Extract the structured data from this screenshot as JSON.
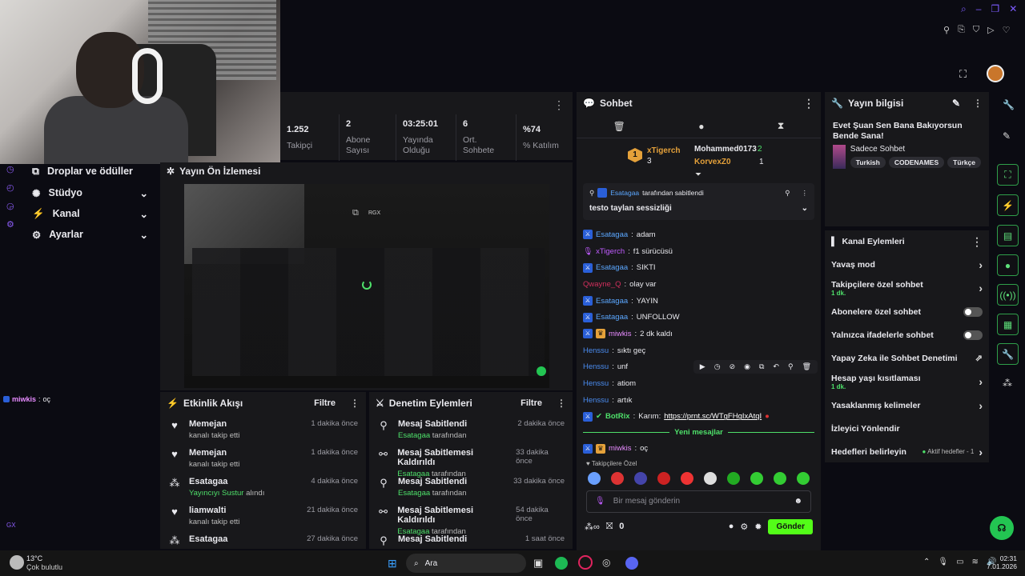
{
  "window": {
    "top_icons": [
      "search-icon",
      "minimize-icon",
      "maximize-icon",
      "close-icon"
    ],
    "action_icons": [
      "pin-icon",
      "clip-icon",
      "shield-icon",
      "play-icon",
      "heart-icon"
    ]
  },
  "nav": {
    "items": [
      {
        "label": "Droplar ve ödüller",
        "icon": "gift-icon"
      },
      {
        "label": "Stüdyo",
        "icon": "gear-icon"
      },
      {
        "label": "Kanal",
        "icon": "channel-icon"
      },
      {
        "label": "Ayarlar",
        "icon": "gear-icon"
      }
    ]
  },
  "left_chat": {
    "user": "miwkis",
    "message": "oç",
    "bottom_label": "GX"
  },
  "stats": [
    {
      "value": "1.252",
      "label": "Takipçi"
    },
    {
      "value": "2",
      "label": "Abone Sayısı"
    },
    {
      "value": "03:25:01",
      "label": "Yayında Olduğu"
    },
    {
      "value": "6",
      "label": "Ort. Sohbete"
    },
    {
      "value": "%74",
      "label": "% Katılım"
    }
  ],
  "preview": {
    "title": "Yayın Ön İzlemesi",
    "badge": "RGX"
  },
  "activity": {
    "title": "Etkinlik Akışı",
    "filter": "Filtre",
    "items": [
      {
        "icon": "heart-icon",
        "name": "Memejan",
        "detail": "kanalı takip etti",
        "time": "1 dakika önce"
      },
      {
        "icon": "heart-icon",
        "name": "Memejan",
        "detail": "kanalı takip etti",
        "time": "1 dakika önce"
      },
      {
        "icon": "points-icon",
        "name": "Esatagaa",
        "detail_highlight": "Yayıncıyı Sustur",
        "detail": "alındı",
        "time": "4 dakika önce"
      },
      {
        "icon": "heart-icon",
        "name": "liamwalti",
        "detail": "kanalı takip etti",
        "time": "21 dakika önce"
      },
      {
        "icon": "points-icon",
        "name": "Esatagaa",
        "detail": "",
        "time": "27 dakika önce"
      }
    ]
  },
  "moderation": {
    "title": "Denetim Eylemleri",
    "filter": "Filtre",
    "items": [
      {
        "icon": "pin-icon",
        "action": "Mesaj Sabitlendi",
        "by": "Esatagaa",
        "suffix": "tarafından",
        "time": "2 dakika önce"
      },
      {
        "icon": "unpin-icon",
        "action": "Mesaj Sabitlemesi Kaldırıldı",
        "by": "Esatagaa",
        "suffix": "tarafından",
        "time": "33 dakika önce"
      },
      {
        "icon": "pin-icon",
        "action": "Mesaj Sabitlendi",
        "by": "Esatagaa",
        "suffix": "tarafından",
        "time": "33 dakika önce"
      },
      {
        "icon": "unpin-icon",
        "action": "Mesaj Sabitlemesi Kaldırıldı",
        "by": "Esatagaa",
        "suffix": "tarafından",
        "time": "54 dakika önce"
      },
      {
        "icon": "pin-icon",
        "action": "Mesaj Sabitlendi",
        "by": "",
        "suffix": "",
        "time": "1 saat önce"
      }
    ]
  },
  "chat": {
    "title": "Sohbet",
    "leaders": [
      {
        "rank": "1",
        "name": "xTigerch",
        "count": "3"
      },
      {
        "name": "Mohammed0173",
        "count": "2"
      },
      {
        "name": "KorvexZ0",
        "count": "1"
      }
    ],
    "pinned": {
      "by": "Esatagaa",
      "by_suffix": "tarafından sabitlendi",
      "text": "testo taylan sessizliği"
    },
    "messages": [
      {
        "badges": [
          "mod"
        ],
        "user": "Esatagaa",
        "color": "#5ba7ff",
        "text": "adam"
      },
      {
        "badges": [
          "mic"
        ],
        "user": "xTigerch",
        "color": "#c05cff",
        "text": "f1 sürücüsü"
      },
      {
        "badges": [
          "mod"
        ],
        "user": "Esatagaa",
        "color": "#5ba7ff",
        "text": "SIKTI"
      },
      {
        "badges": [],
        "user": "Qwayne_Q",
        "color": "#d12f5d",
        "text": "olay var"
      },
      {
        "badges": [
          "mod"
        ],
        "user": "Esatagaa",
        "color": "#5ba7ff",
        "text": "YAYIN"
      },
      {
        "badges": [
          "mod"
        ],
        "user": "Esatagaa",
        "color": "#5ba7ff",
        "text": "UNFOLLOW"
      },
      {
        "badges": [
          "mod",
          "vip"
        ],
        "user": "miwkis",
        "color": "#e78bff",
        "text": "2 dk kaldı"
      },
      {
        "badges": [],
        "user": "Henssu",
        "color": "#4a8cf0",
        "text": "sıktı geç"
      },
      {
        "badges": [],
        "user": "Henssu",
        "color": "#4a8cf0",
        "text": "unf"
      },
      {
        "badges": [],
        "user": "Henssu",
        "color": "#4a8cf0",
        "text": "atiom"
      },
      {
        "badges": [],
        "user": "Henssu",
        "color": "#4a8cf0",
        "text": "artık"
      },
      {
        "badges": [
          "mod",
          "bot"
        ],
        "user": "BotRix",
        "color": "#52e06c",
        "text": "Karım:",
        "link": "https://prnt.sc/WTgFHgIxAtqI"
      }
    ],
    "new_messages": "Yeni mesajlar",
    "after": {
      "user": "miwkis",
      "text": "oç"
    },
    "emote_label": "Takipçilere Özel",
    "input_placeholder": "Bir mesaj gönderin",
    "points": "0",
    "send": "Gönder"
  },
  "stream_info": {
    "title_label": "Yayın bilgisi",
    "title": "Evet Şuan Sen Bana Bakıyorsun Bende Sana!",
    "category": "Sadece Sohbet",
    "tags": [
      "Turkish",
      "CODENAMES",
      "Türkçe"
    ]
  },
  "channel_actions": {
    "title": "Kanal Eylemleri",
    "items": [
      {
        "label": "Yavaş mod",
        "type": "arrow"
      },
      {
        "label": "Takipçilere özel sohbet",
        "sub": "1 dk.",
        "type": "arrow"
      },
      {
        "label": "Abonelere özel sohbet",
        "type": "toggle"
      },
      {
        "label": "Yalnızca ifadelerle sohbet",
        "type": "toggle"
      },
      {
        "label": "Yapay Zeka ile Sohbet Denetimi",
        "type": "external"
      },
      {
        "label": "Hesap yaşı kısıtlaması",
        "sub": "1 dk.",
        "type": "arrow"
      },
      {
        "label": "Yasaklanmış kelimeler",
        "type": "arrow"
      },
      {
        "label": "İzleyici Yönlendir",
        "type": "none"
      },
      {
        "label": "Hedefleri belirleyin",
        "status": "Aktif hedefler - 1",
        "type": "arrow"
      }
    ]
  },
  "taskbar": {
    "weather_temp": "13°C",
    "weather_desc": "Çok bulutlu",
    "search": "Ara",
    "time": "02:31",
    "date": "7.01.2026"
  }
}
